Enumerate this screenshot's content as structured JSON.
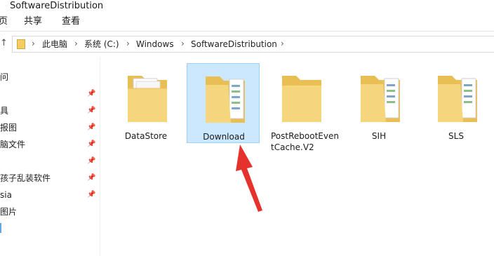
{
  "window": {
    "title": "SoftwareDistribution"
  },
  "ribbon": {
    "tabs": [
      "页",
      "共享",
      "查看"
    ]
  },
  "address": {
    "crumbs": [
      "此电脑",
      "系统 (C:)",
      "Windows",
      "SoftwareDistribution"
    ]
  },
  "sidebar": {
    "items": [
      "问",
      "具",
      "报图",
      "脑文件",
      "孩子乱装软件",
      "sia",
      "图片"
    ]
  },
  "folders": [
    {
      "name": "DataStore",
      "selected": false
    },
    {
      "name": "Download",
      "selected": true
    },
    {
      "name": "PostRebootEventCache.V2",
      "selected": false
    },
    {
      "name": "SIH",
      "selected": false
    },
    {
      "name": "SLS",
      "selected": false
    }
  ],
  "colors": {
    "selection": "#cce8ff",
    "selection_border": "#99d1ff",
    "folder_yellow": "#f5d47b",
    "arrow_red": "#e5322d"
  }
}
